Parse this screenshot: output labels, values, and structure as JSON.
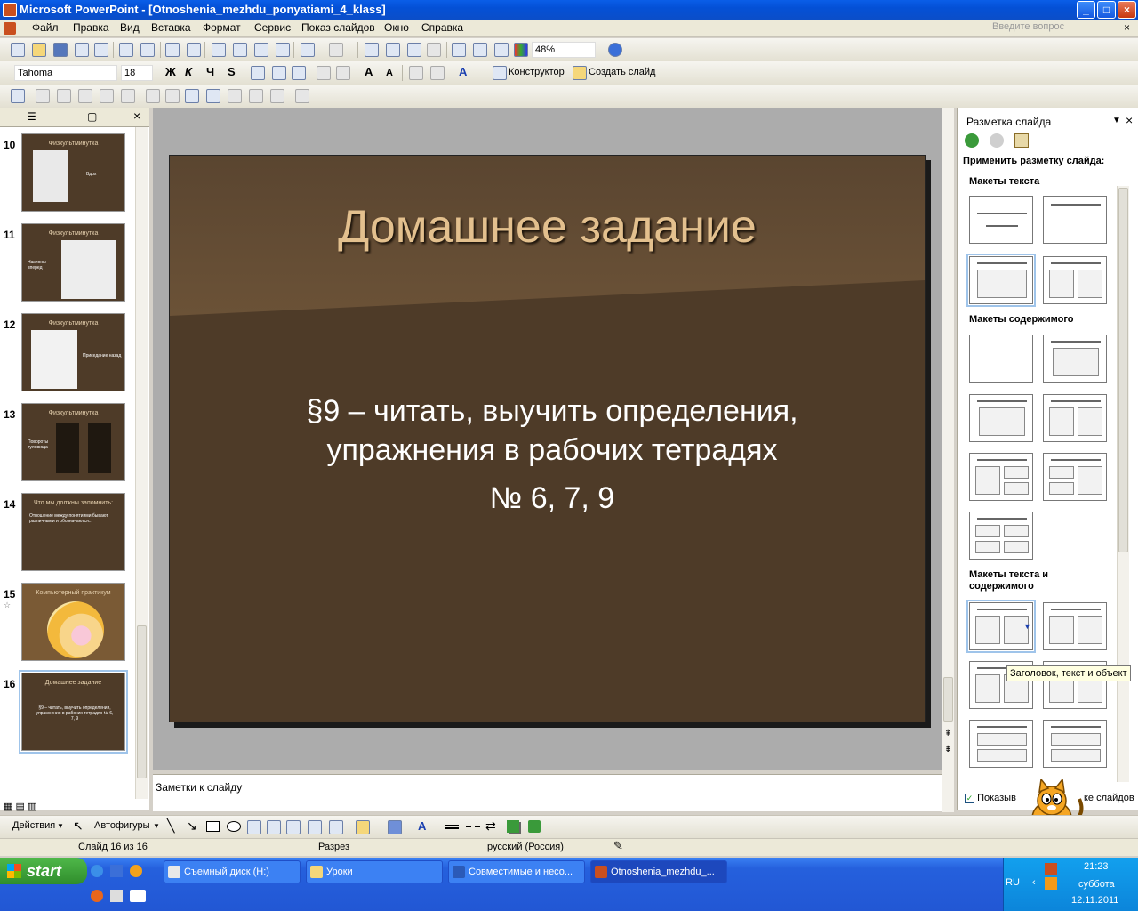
{
  "window": {
    "title": "Microsoft PowerPoint - [Otnoshenia_mezhdu_ponyatiami_4_klass]"
  },
  "menu": {
    "items": [
      "Файл",
      "Правка",
      "Вид",
      "Вставка",
      "Формат",
      "Сервис",
      "Показ слайдов",
      "Окно",
      "Справка"
    ],
    "ask_placeholder": "Введите вопрос"
  },
  "toolbar": {
    "zoom": "48%",
    "font": "Tahoma",
    "size": "18",
    "designer": "Конструктор",
    "new_slide": "Создать слайд"
  },
  "thumbnails": [
    {
      "num": "10",
      "title": "Физкультминутка",
      "text": "Вдох"
    },
    {
      "num": "11",
      "title": "Физкультминутка",
      "text": "Наклоны вперед"
    },
    {
      "num": "12",
      "title": "Физкультминутка",
      "text": "Приседание назад"
    },
    {
      "num": "13",
      "title": "Физкультминутка",
      "text": "Повороты туловища"
    },
    {
      "num": "14",
      "title": "Что мы должны запомнить:",
      "text": "Отношение между понятиями бывают различными и обозначаются..."
    },
    {
      "num": "15",
      "title": "Компьютерный практикум",
      "text": ""
    },
    {
      "num": "16",
      "title": "Домашнее задание",
      "text": "§9 – читать, выучить определения, упражнения в рабочих тетрадях № 6, 7, 9"
    }
  ],
  "slide": {
    "title": "Домашнее задание",
    "body_line1": "§9 – читать, выучить определения,",
    "body_line2": "упражнения в рабочих тетрадях",
    "body_line3": "№ 6, 7, 9"
  },
  "notes": {
    "placeholder": "Заметки к слайду"
  },
  "taskpane": {
    "title": "Разметка слайда",
    "apply": "Применить разметку слайда:",
    "sec_text": "Макеты текста",
    "sec_content": "Макеты содержимого",
    "sec_text_content_1": "Макеты текста и",
    "sec_text_content_2": "содержимого",
    "tooltip": "Заголовок, текст и объект",
    "show_label": "Показыв",
    "show_label_end": "ке слайдов"
  },
  "drawbar": {
    "actions": "Действия",
    "autoshapes": "Автофигуры"
  },
  "status": {
    "slide": "Слайд 16 из 16",
    "design": "Разрез",
    "language": "русский (Россия)"
  },
  "taskbar": {
    "start": "start",
    "items": [
      "Съемный диск (H:)",
      "Уроки",
      "Совместимые и несо...",
      "Otnoshenia_mezhdu_..."
    ],
    "lang": "RU",
    "time": "21:23",
    "day": "суббота",
    "date": "12.11.2011"
  },
  "colors": {
    "slide_bg": "#4e3b28",
    "slide_title": "#e3c08e",
    "xp_blue": "#2257d4"
  }
}
